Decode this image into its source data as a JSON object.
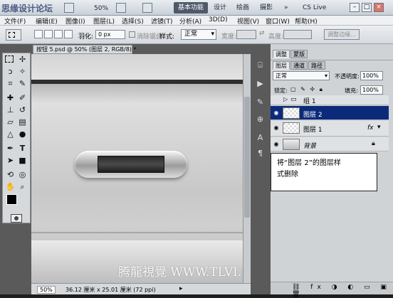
{
  "app": {
    "watermark": "思缘设计论坛",
    "zoom": "50%",
    "workspaces": [
      "基本功能",
      "设计",
      "绘画",
      "摄影"
    ],
    "active_workspace": "基本功能",
    "cs_live": "CS Live",
    "more": "»"
  },
  "menu": [
    "文件(F)",
    "编辑(E)",
    "图像(I)",
    "图层(L)",
    "选择(S)",
    "滤镜(T)",
    "分析(A)",
    "3D(D)",
    "视图(V)",
    "窗口(W)",
    "帮助(H)"
  ],
  "options": {
    "feather_label": "羽化:",
    "feather_value": "0 px",
    "antialias_label": "消除锯齿",
    "style_label": "样式:",
    "style_value": "正常",
    "width_label": "宽度:",
    "height_label": "高度:",
    "refine_edge": "调整边缘..."
  },
  "document": {
    "tab_title": "按钮 5.psd @ 50% (图层 2, RGB/8) *",
    "zoom": "50%",
    "doc_size": "36.12 厘米 x 25.01 厘米 (72 ppi)",
    "watermark": "腾龍視覺 WWW.TLVI.NET"
  },
  "panels": {
    "top_tabs": [
      "调整",
      "蒙版"
    ],
    "layer_tabs": [
      "图层",
      "通道",
      "路径"
    ],
    "blend_mode": "正常",
    "opacity_label": "不透明度:",
    "opacity_value": "100%",
    "lock_label": "锁定:",
    "fill_label": "填充:",
    "fill_value": "100%",
    "layers": [
      {
        "name": "组 1",
        "type": "group",
        "visible": false,
        "selected": false
      },
      {
        "name": "图层 2",
        "type": "layer",
        "visible": true,
        "selected": true
      },
      {
        "name": "图层 1",
        "type": "layer",
        "visible": true,
        "selected": false,
        "fx": "fx"
      },
      {
        "name": "背景",
        "type": "background",
        "visible": true,
        "selected": false
      }
    ]
  },
  "tooltip": {
    "line1": "将“图层 2”的图层样",
    "line2": "式删除"
  },
  "colors": {
    "selected_layer": "#0c2a7a",
    "active_workspace_bg": "#4e5a68"
  }
}
